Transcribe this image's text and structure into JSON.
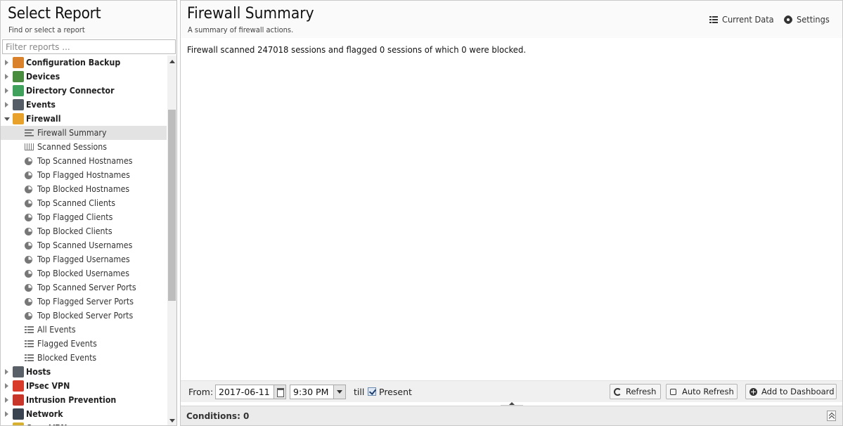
{
  "left_panel": {
    "title": "Select Report",
    "subtitle": "Find or select a report",
    "filter_placeholder": "Filter reports ..."
  },
  "categories": [
    {
      "label": "Configuration Backup",
      "icon": "configuration-backup-icon",
      "color": "#d9822b",
      "state": "collapsed"
    },
    {
      "label": "Devices",
      "icon": "devices-icon",
      "color": "#4a8c3f",
      "state": "collapsed"
    },
    {
      "label": "Directory Connector",
      "icon": "directory-connector-icon",
      "color": "#3fa15b",
      "state": "collapsed"
    },
    {
      "label": "Events",
      "icon": "events-icon",
      "color": "#555d66",
      "state": "collapsed"
    },
    {
      "label": "Firewall",
      "icon": "firewall-icon",
      "color": "#e8a12a",
      "state": "expanded",
      "reports": [
        {
          "label": "Firewall Summary",
          "icon": "text-report-icon",
          "selected": true
        },
        {
          "label": "Scanned Sessions",
          "icon": "bar-chart-icon"
        },
        {
          "label": "Top Scanned Hostnames",
          "icon": "pie-chart-icon"
        },
        {
          "label": "Top Flagged Hostnames",
          "icon": "pie-chart-icon"
        },
        {
          "label": "Top Blocked Hostnames",
          "icon": "pie-chart-icon"
        },
        {
          "label": "Top Scanned Clients",
          "icon": "pie-chart-icon"
        },
        {
          "label": "Top Flagged Clients",
          "icon": "pie-chart-icon"
        },
        {
          "label": "Top Blocked Clients",
          "icon": "pie-chart-icon"
        },
        {
          "label": "Top Scanned Usernames",
          "icon": "pie-chart-icon"
        },
        {
          "label": "Top Flagged Usernames",
          "icon": "pie-chart-icon"
        },
        {
          "label": "Top Blocked Usernames",
          "icon": "pie-chart-icon"
        },
        {
          "label": "Top Scanned Server Ports",
          "icon": "pie-chart-icon"
        },
        {
          "label": "Top Flagged Server Ports",
          "icon": "pie-chart-icon"
        },
        {
          "label": "Top Blocked Server Ports",
          "icon": "pie-chart-icon"
        },
        {
          "label": "All Events",
          "icon": "list-icon"
        },
        {
          "label": "Flagged Events",
          "icon": "list-icon"
        },
        {
          "label": "Blocked Events",
          "icon": "list-icon"
        }
      ]
    },
    {
      "label": "Hosts",
      "icon": "hosts-icon",
      "color": "#5a6068",
      "state": "collapsed"
    },
    {
      "label": "IPsec VPN",
      "icon": "ipsec-vpn-icon",
      "color": "#d93b2b",
      "state": "collapsed"
    },
    {
      "label": "Intrusion Prevention",
      "icon": "intrusion-prevention-icon",
      "color": "#c8362a",
      "state": "collapsed"
    },
    {
      "label": "Network",
      "icon": "network-icon",
      "color": "#3a4450",
      "state": "collapsed"
    },
    {
      "label": "OpenVPN",
      "icon": "openvpn-icon",
      "color": "#d8b030",
      "state": "collapsed"
    }
  ],
  "main": {
    "title": "Firewall Summary",
    "subtitle": "A summary of firewall actions.",
    "current_data_label": "Current Data",
    "settings_label": "Settings",
    "summary_text": "Firewall scanned 247018 sessions and flagged 0 sessions of which 0 were blocked."
  },
  "toolbar": {
    "from_label": "From:",
    "date_value": "2017-06-11",
    "time_value": "9:30 PM",
    "till_label": "till",
    "present_label": "Present",
    "present_checked": true,
    "refresh_label": "Refresh",
    "auto_refresh_label": "Auto Refresh",
    "add_dashboard_label": "Add to Dashboard"
  },
  "conditions": {
    "label": "Conditions: 0"
  }
}
